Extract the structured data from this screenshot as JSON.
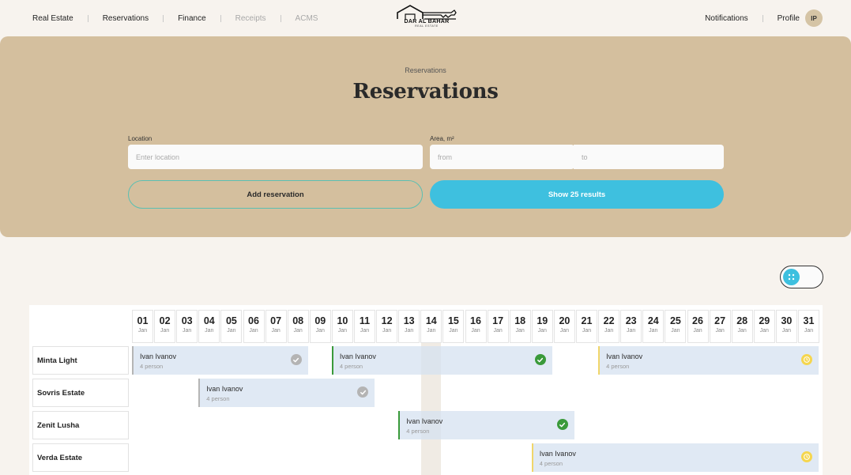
{
  "nav": {
    "items": [
      {
        "label": "Real Estate",
        "muted": false
      },
      {
        "label": "Reservations",
        "muted": false
      },
      {
        "label": "Finance",
        "muted": false
      },
      {
        "label": "Receipts",
        "muted": true
      },
      {
        "label": "ACMS",
        "muted": true
      }
    ],
    "logo": {
      "title": "DAR AL BAHAR",
      "subtitle": "REAL ESTATE"
    },
    "notifications_label": "Notifications",
    "profile_label": "Profile",
    "avatar_initials": "IP"
  },
  "hero": {
    "breadcrumb": "Reservations",
    "title": "Reservations",
    "location_label": "Location",
    "location_placeholder": "Enter location",
    "area_label": "Area, m²",
    "area_from_placeholder": "from",
    "area_to_placeholder": "to",
    "add_button": "Add reservation",
    "show_button": "Show 25 results"
  },
  "colors": {
    "accent": "#3ec0df",
    "hero_bg": "#d4bf9e",
    "status_confirmed": "#3a9a3a",
    "status_pending": "#f5d64f",
    "status_default": "#b4b4b4"
  },
  "calendar": {
    "month_label": "Jan",
    "highlight_day": "14",
    "days": [
      "01",
      "02",
      "03",
      "04",
      "05",
      "06",
      "07",
      "08",
      "09",
      "10",
      "11",
      "12",
      "13",
      "14",
      "15",
      "16",
      "17",
      "18",
      "19",
      "20",
      "21",
      "22",
      "23",
      "24",
      "25",
      "26",
      "27",
      "28",
      "29",
      "30",
      "31"
    ],
    "rows": [
      {
        "property": "Minta Light",
        "reservations": [
          {
            "guest": "Ivan Ivanov",
            "persons": "4 person",
            "start": 1,
            "end": 8,
            "status": "gray"
          },
          {
            "guest": "Ivan Ivanov",
            "persons": "4 person",
            "start": 10,
            "end": 19,
            "status": "green"
          },
          {
            "guest": "Ivan Ivanov",
            "persons": "4 person",
            "start": 22,
            "end": 31,
            "status": "yellow"
          }
        ]
      },
      {
        "property": "Sovris Estate",
        "reservations": [
          {
            "guest": "Ivan Ivanov",
            "persons": "4 person",
            "start": 4,
            "end": 11,
            "status": "gray"
          }
        ]
      },
      {
        "property": "Zenit Lusha",
        "reservations": [
          {
            "guest": "Ivan Ivanov",
            "persons": "4 person",
            "start": 13,
            "end": 20,
            "status": "green"
          }
        ]
      },
      {
        "property": "Verda Estate",
        "reservations": [
          {
            "guest": "Ivan Ivanov",
            "persons": "4 person",
            "start": 19,
            "end": 31,
            "status": "yellow"
          }
        ]
      }
    ]
  }
}
